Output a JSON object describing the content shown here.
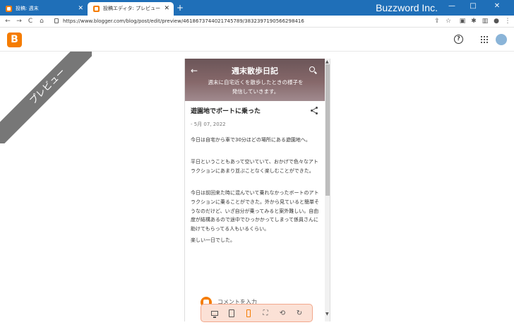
{
  "browser": {
    "tabs": [
      {
        "label": "投稿: 週末"
      },
      {
        "label": "投稿エディタ: プレビュー"
      }
    ],
    "new_tab": "+",
    "brand_watermark": "Buzzword Inc.",
    "window_controls": {
      "minimize": "—",
      "maximize": "□",
      "close": "✕"
    },
    "tab_close": "✕",
    "url": "https://www.blogger.com/blog/post/edit/preview/4618673744021745789/383239719056629841​6",
    "nav": {
      "back": "←",
      "forward": "→",
      "reload": "C",
      "home": "⌂"
    }
  },
  "blogger": {
    "ribbon_label": "プレビュー"
  },
  "preview": {
    "blog_title": "週末散歩日記",
    "blog_description": "週末に自宅近くを散歩したときの様子を発信していきます。",
    "post_title": "遊園地でボートに乗った",
    "post_date": "- 5月 07, 2022",
    "paragraphs": [
      "今日は自宅から車で30分ほどの場所にある遊園地へ。",
      "平日ということもあって空いていて、おかげで色々なアトラクションにあまり並ぶことなく楽しむことができた。",
      "今日は前回来た時に混んでいて乗れなかったボートのアトラクションに乗ることができた。外から見ていると簡単そうなのだけど、いざ自分が乗ってみると案外難しい。自由度が結構あるので途中でひっかかってしまって係員さんに助けてもらってる人もいるくらい。",
      "楽しい一日でした。"
    ],
    "comment_placeholder": "コメントを入力"
  },
  "device_toolbar": {
    "active": "mobile",
    "buttons": [
      "desktop-icon",
      "tablet-icon",
      "mobile-icon",
      "fullscreen-icon",
      "rotate-icon",
      "refresh-icon"
    ]
  },
  "colors": {
    "tabbar": "#1f6fb8",
    "blogger_orange": "#f57c00",
    "ribbon": "#777777",
    "devbar_bg": "#fbe1d6"
  }
}
